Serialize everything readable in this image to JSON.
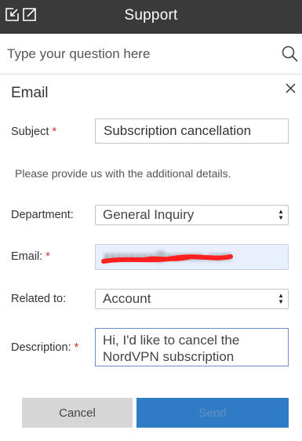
{
  "header": {
    "title": "Support",
    "icons": [
      "minimize-icon",
      "popout-icon"
    ],
    "background_color": "#3a3a3a"
  },
  "search": {
    "placeholder": "Type your question here",
    "icon": "search-icon"
  },
  "form": {
    "title": "Email",
    "close_icon": "close-icon",
    "subject": {
      "label": "Subject",
      "required_mark": "*",
      "value": "Subscription cancellation"
    },
    "info_text": "Please provide us with the additional details.",
    "department": {
      "label": "Department:",
      "value": "General Inquiry"
    },
    "email": {
      "label": "Email:",
      "required_mark": "*",
      "value": "xxxxxxxx@xxxxxx.com",
      "redacted": true
    },
    "related_to": {
      "label": "Related to:",
      "value": "Account"
    },
    "description": {
      "label": "Description:",
      "required_mark": "*",
      "value": "Hi, I'd like to cancel the NordVPN subscription"
    },
    "buttons": {
      "cancel": "Cancel",
      "send": "Send"
    }
  },
  "colors": {
    "required": "#d32f2f",
    "send_button": "#2f7bc4",
    "email_field_bg": "#e8f0fe",
    "redaction_mark": "#ff1f1f"
  }
}
